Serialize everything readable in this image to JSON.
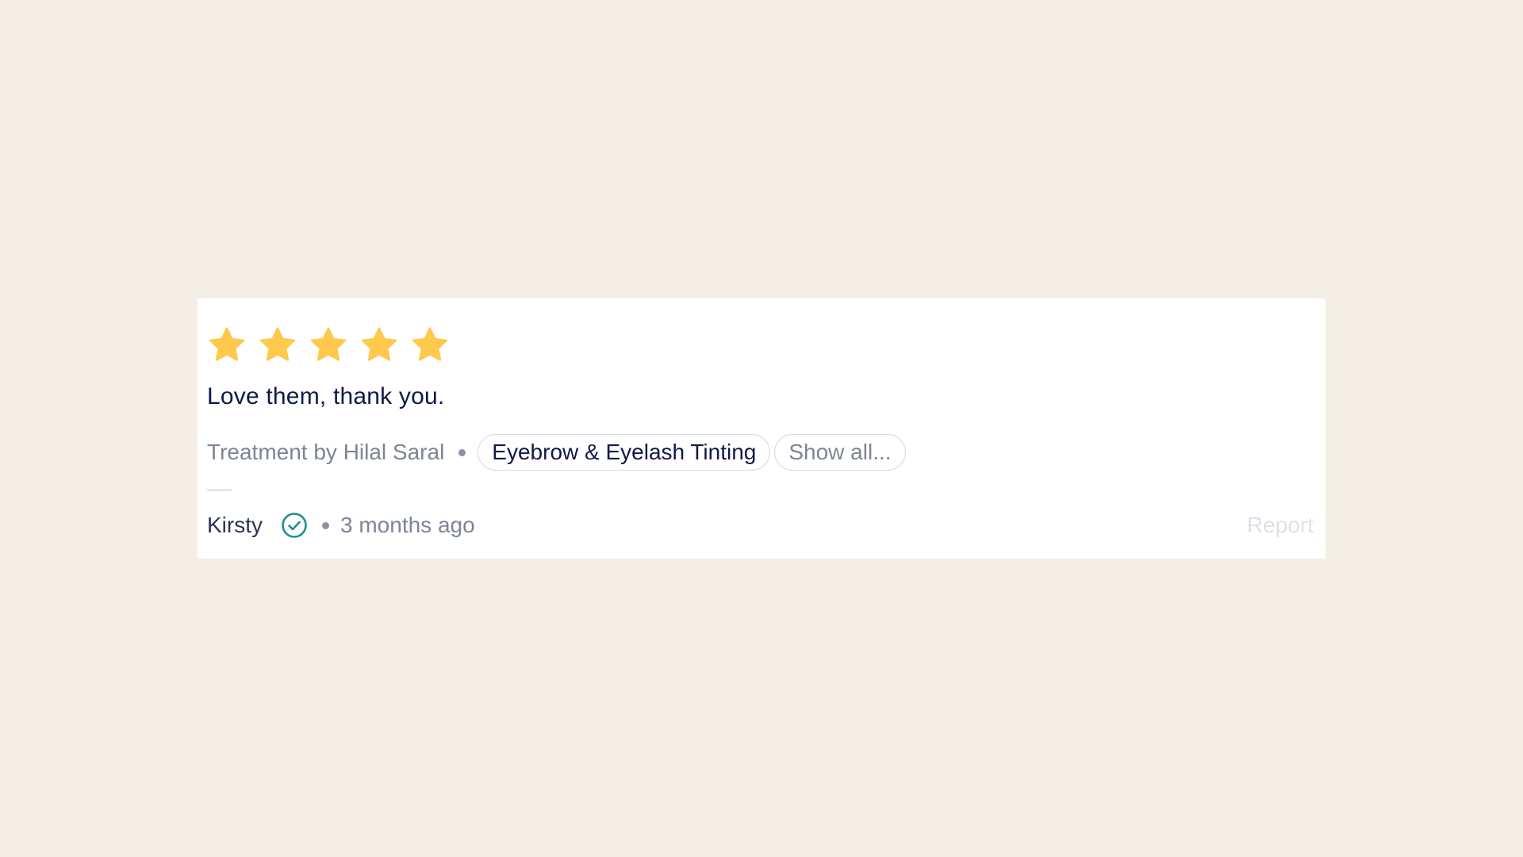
{
  "review": {
    "rating": 5,
    "max_rating": 5,
    "star_color": "#ffc94d",
    "text": "Love them, thank you.",
    "treatment_by": "Treatment by Hilal Saral",
    "treatments": [
      "Eyebrow & Eyelash Tinting"
    ],
    "show_all_label": "Show all...",
    "author": "Kirsty",
    "verified_icon": "verified-check-circle-icon",
    "verified_color": "#1d8f8c",
    "time_ago": "3 months ago",
    "report_label": "Report"
  }
}
